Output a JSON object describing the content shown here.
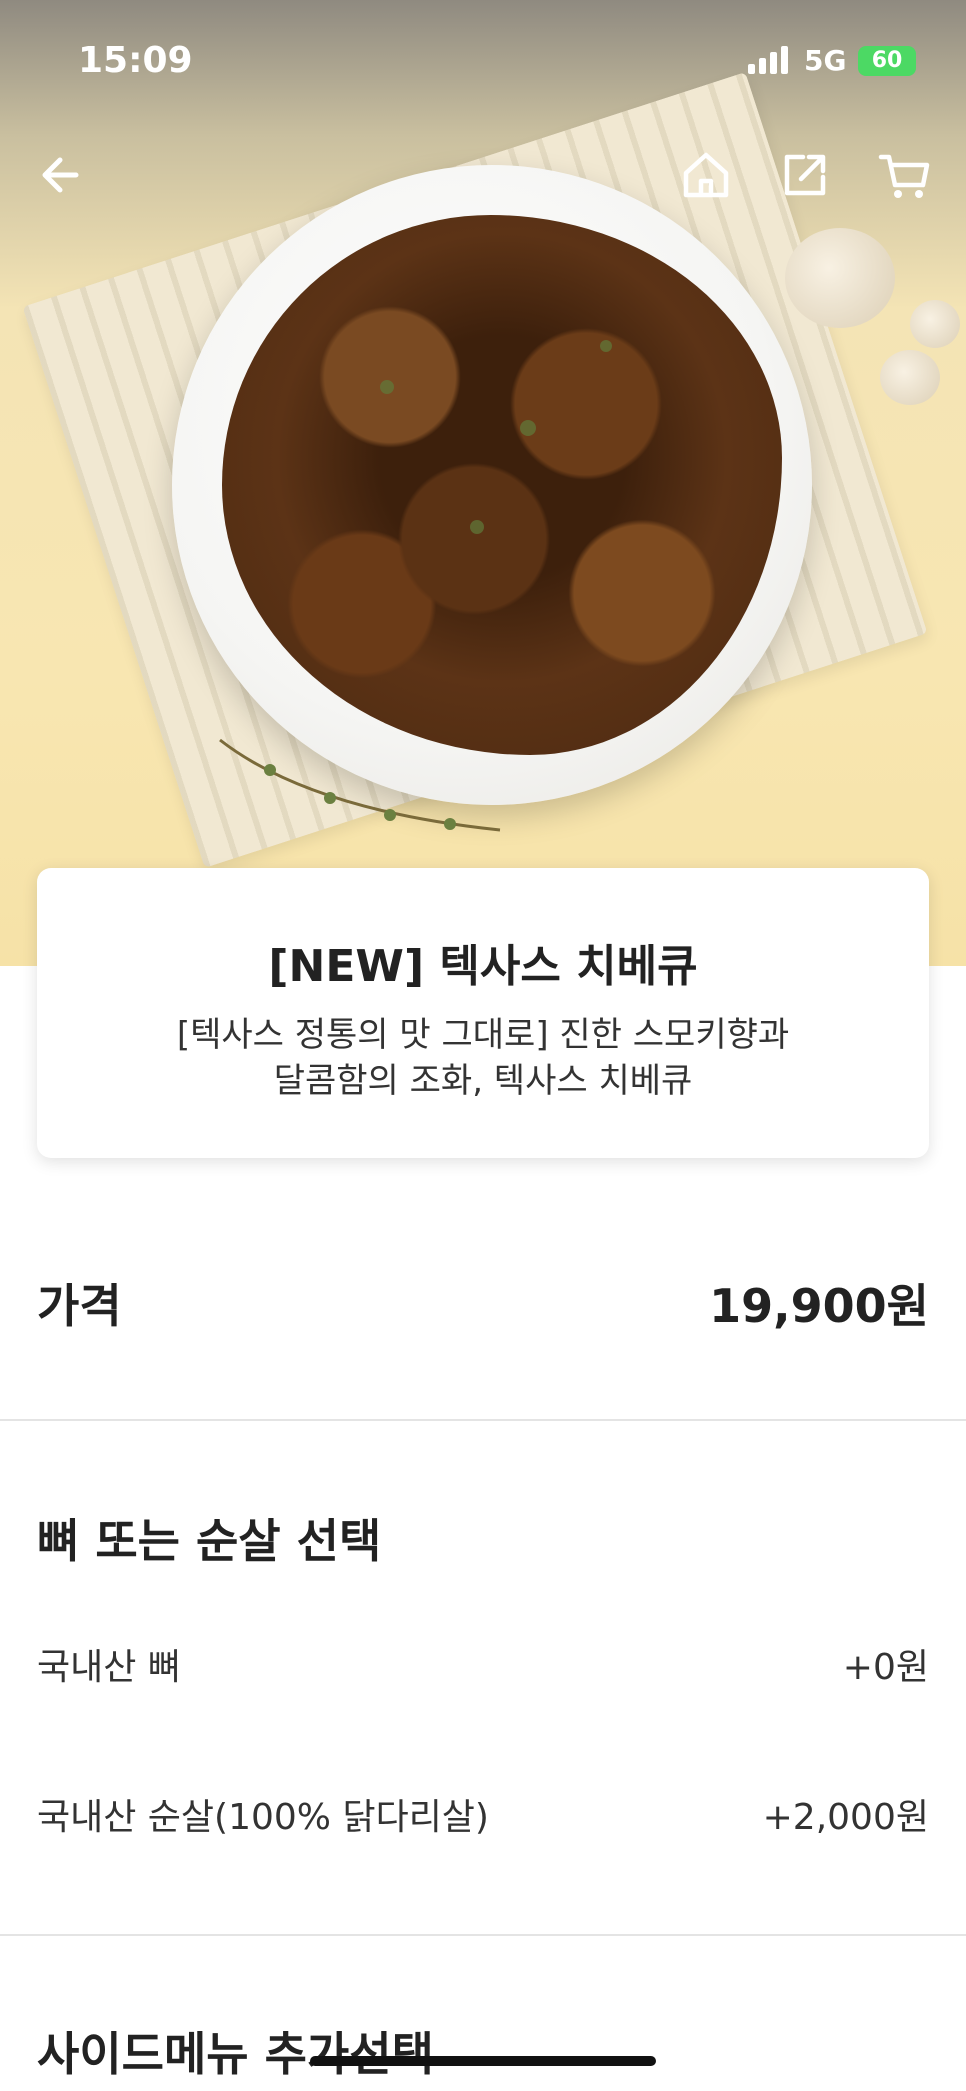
{
  "status_bar": {
    "time": "15:09",
    "network": "5G",
    "battery": "60"
  },
  "top_icons": [
    "back-arrow-icon",
    "home-icon",
    "share-icon",
    "cart-icon"
  ],
  "product": {
    "title": "[NEW] 텍사스 치베큐",
    "description_line1": "[텍사스 정통의 맛 그대로] 진한 스모키향과",
    "description_line2": "달콤함의 조화, 텍사스 치베큐"
  },
  "price": {
    "label": "가격",
    "value": "19,900원"
  },
  "bone_section": {
    "title": "뼈 또는 순살 선택",
    "options": [
      {
        "label": "국내산 뼈",
        "price": "+0원"
      },
      {
        "label": "국내산 순살(100% 닭다리살)",
        "price": "+2,000원"
      }
    ]
  },
  "side_section": {
    "title": "사이드메뉴 추가선택"
  },
  "colors": {
    "accent_battery": "#4cd964",
    "text": "#222222",
    "divider": "#e4e4e4"
  }
}
